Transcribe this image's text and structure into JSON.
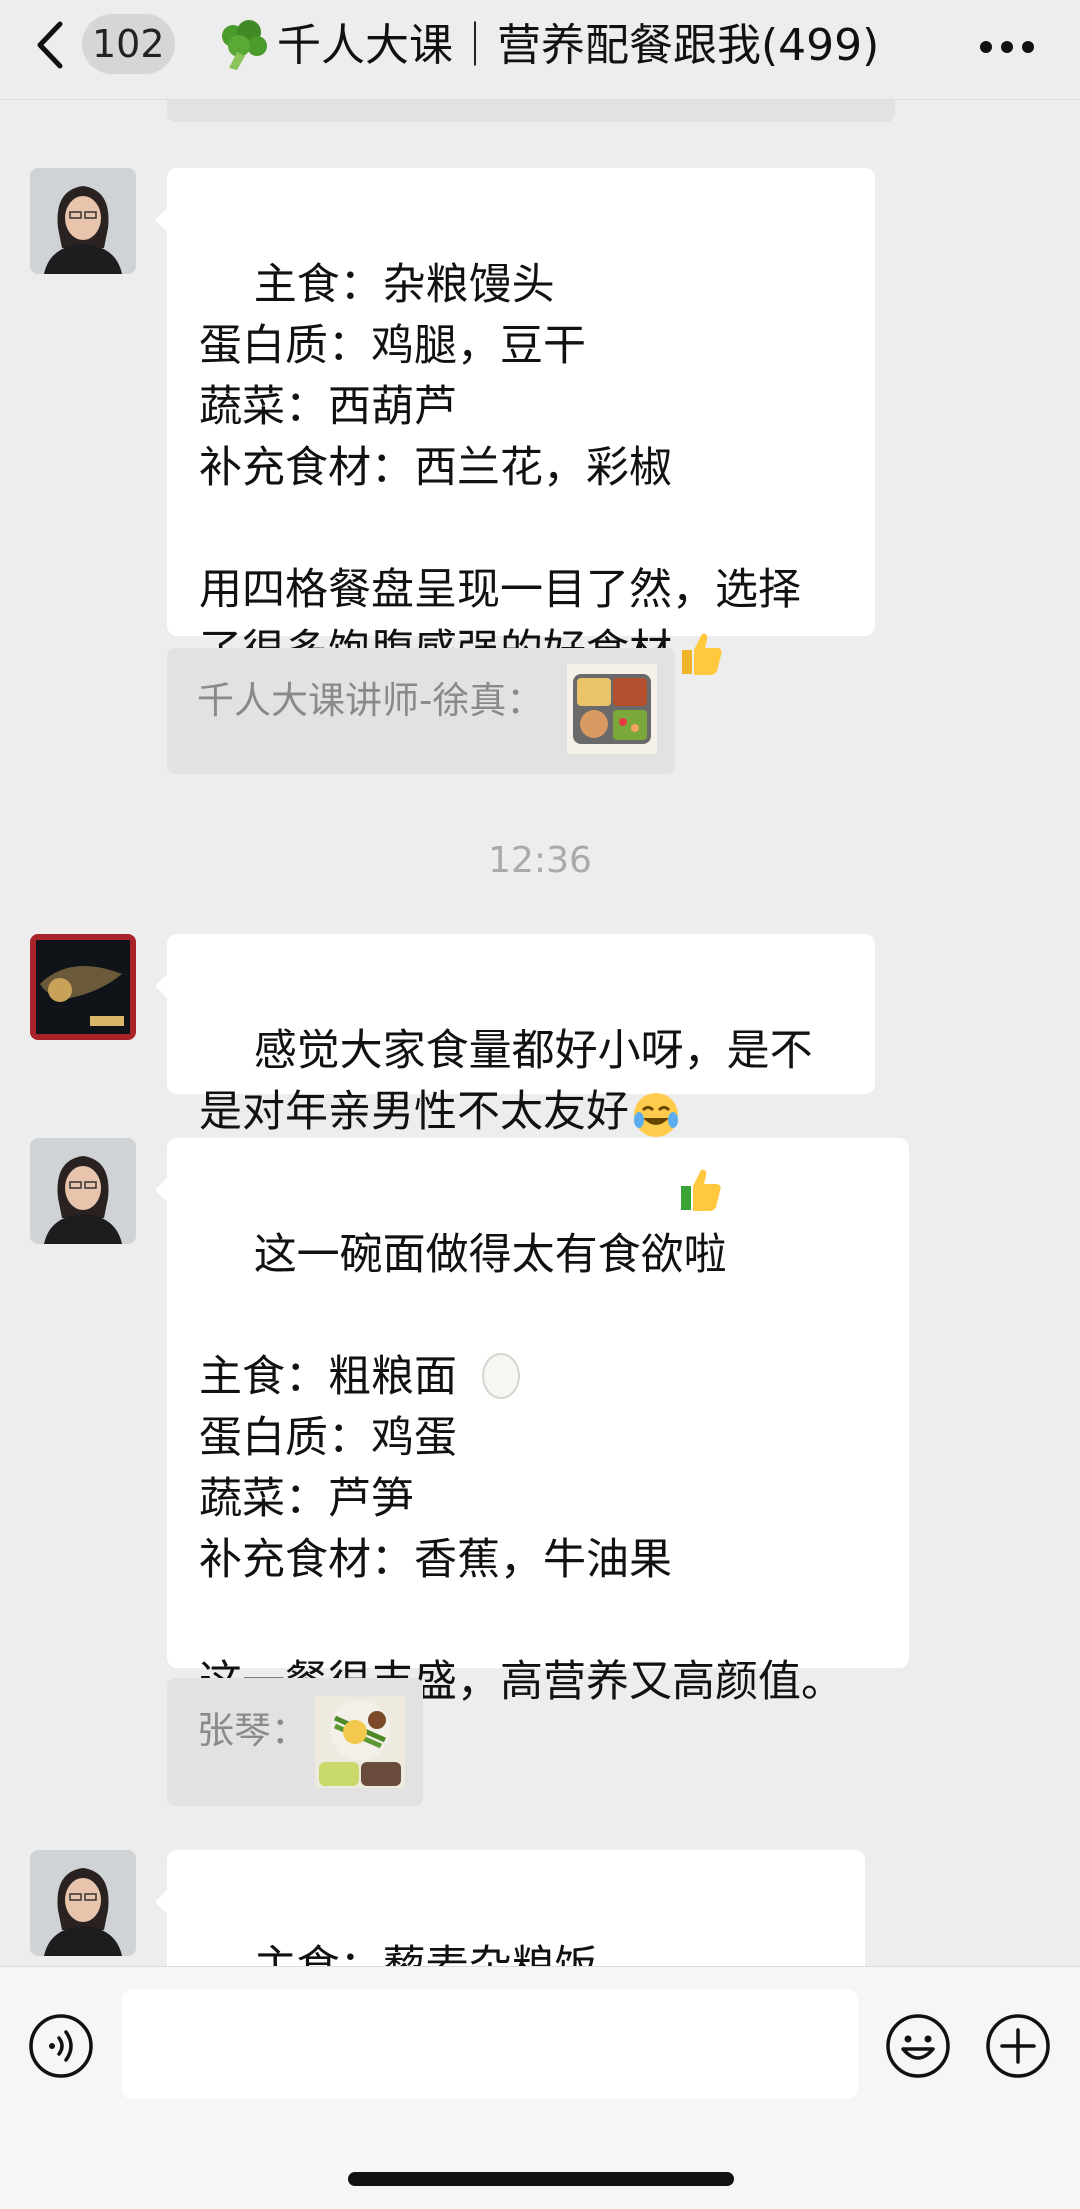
{
  "header": {
    "unread_count": "102",
    "title": "千人大课｜营养配餐跟我",
    "member_count": "(499)"
  },
  "messages": {
    "m1": {
      "text": "主食：杂粮馒头\n蛋白质：鸡腿，豆干\n蔬菜：西葫芦\n补充食材：西兰花，彩椒\n\n用四格餐盘呈现一目了然，选择了很多饱腹感强的好食材"
    },
    "q1": {
      "label": "千人大课讲师-徐真："
    },
    "time1": "12:36",
    "m2": {
      "text": "感觉大家食量都好小呀，是不是对年亲男性不太友好"
    },
    "m3": {
      "text": "这一碗面做得太有食欲啦\n\n主食：粗粮面\n蛋白质：鸡蛋\n蔬菜：芦笋\n补充食材：香蕉，牛油果\n\n这一餐很丰盛，高营养又高颜值。"
    },
    "q2": {
      "label": "张琴："
    },
    "m4": {
      "text": "主食：藜麦杂粮饭\n蛋白质：瘦肉丸，豆制品"
    }
  },
  "icons": {
    "back": "chevron-left-icon",
    "more": "more-dots-icon",
    "voice": "voice-icon",
    "emoji": "emoji-icon",
    "plus": "plus-icon"
  }
}
